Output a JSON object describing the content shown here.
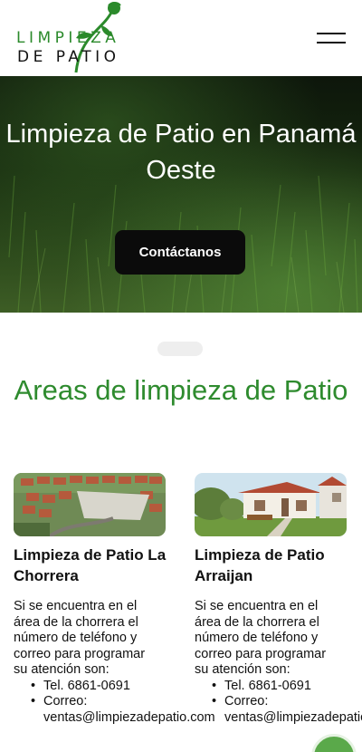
{
  "header": {
    "logo": {
      "line1": "LIMPIEZA",
      "line2": "DE PATIO",
      "icon": "rose-stem-logo-icon"
    },
    "menu_icon": "hamburger-menu-icon"
  },
  "hero": {
    "title": "Limpieza de Patio en Panamá Oeste",
    "cta_label": "Contáctanos"
  },
  "areas": {
    "title": "Areas de limpieza de Patio",
    "cards": [
      {
        "title": "Limpieza de Patio La Chorrera",
        "text_lines": [
          "Si se encuentra en el",
          "área de la chorrera el",
          "número de teléfono y",
          "correo para programar",
          "su atención son:"
        ],
        "phone": "Tel. 6861-0691",
        "email_label": "Correo:",
        "email": "ventas@limpiezadepatio.com",
        "image_icon": "aerial-neighborhood-image"
      },
      {
        "title": "Limpieza de Patio Arraijan",
        "text_lines": [
          "Si se encuentra en el",
          "área de la chorrera el",
          "número de teléfono y",
          "correo para programar",
          "su atención son:"
        ],
        "phone": "Tel. 6861-0691",
        "email_label": "Correo:",
        "email": "ventas@limpiezadepatio.com",
        "image_icon": "house-image"
      }
    ]
  },
  "whatsapp_icon": "whatsapp-icon",
  "colors": {
    "brand_green": "#2e8b2e",
    "button_dark": "#0b0b0b",
    "whatsapp_green": "#5aa94a"
  }
}
